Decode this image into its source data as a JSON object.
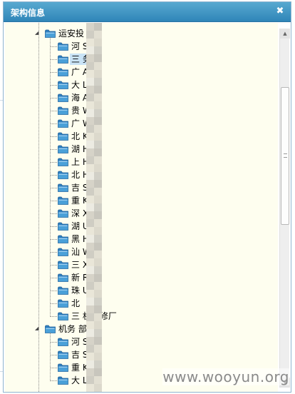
{
  "dialog": {
    "title": "架构信息",
    "close_glyph": "✖"
  },
  "tree": {
    "groups": [
      {
        "label": "运安投",
        "expanded": true,
        "items": [
          "河 SO",
          "三 务",
          "广 AN",
          "大 LC",
          "海 AK",
          "贵 WE",
          "广 WL",
          "北 K",
          "湖 HA",
          "上 HA",
          "北 HE",
          "吉 SQ",
          "重 KG",
          "深 X",
          "湖 UH",
          "黑 HRB",
          "汕 WA",
          "三 X",
          "新 RC",
          "珠 UH",
          "北",
          "三 机维修厂"
        ]
      },
      {
        "label": "机务 部",
        "expanded": true,
        "items": [
          "河 SO",
          "吉 SQ",
          "重 KG",
          "大 LC"
        ]
      }
    ],
    "selected_index": 1
  },
  "watermark": "www.wooyun.org",
  "colors": {
    "titlebar": "#3c95c4",
    "panel_bg": "#fefeef",
    "folder": "#4aa0d8",
    "selection": "#c9e3f6"
  }
}
